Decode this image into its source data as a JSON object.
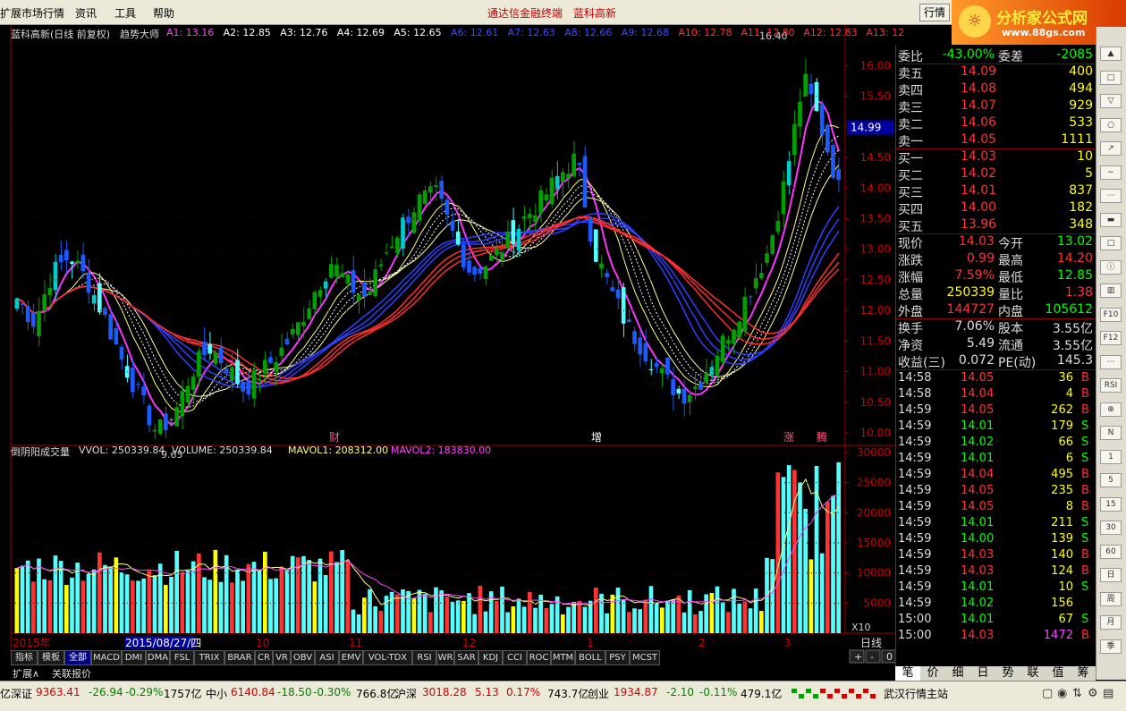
{
  "menubar": {
    "items": [
      "扩展市场行情",
      "资讯",
      "工具",
      "帮助"
    ],
    "app_title": "通达信金融终端",
    "stock_name": "蓝科高新",
    "quote_button": "行情"
  },
  "logo": {
    "title": "分析家公式网",
    "url": "www.88gs.com"
  },
  "main_chart": {
    "header_name": "蓝科高新(日线 前复权)",
    "header_indicator": "趋势大师",
    "lines": [
      {
        "label": "A1: 13.16",
        "color": "#ff44ff"
      },
      {
        "label": "A2: 12.85",
        "color": "#ffffff"
      },
      {
        "label": "A3: 12.76",
        "color": "#ffffff"
      },
      {
        "label": "A4: 12.69",
        "color": "#ffffff"
      },
      {
        "label": "A5: 12.65",
        "color": "#ffffff"
      },
      {
        "label": "A6: 12.61",
        "color": "#3b4bff"
      },
      {
        "label": "A7: 12.63",
        "color": "#3b4bff"
      },
      {
        "label": "A8: 12.66",
        "color": "#3b4bff"
      },
      {
        "label": "A9: 12.68",
        "color": "#3b4bff"
      },
      {
        "label": "A10: 12.78",
        "color": "#ff3333"
      },
      {
        "label": "A11: 12.80",
        "color": "#ff3333"
      },
      {
        "label": "A12: 12.83",
        "color": "#ff3333"
      },
      {
        "label": "A13: 12",
        "color": "#ff3333"
      }
    ],
    "price_axis": [
      "16.00",
      "15.50",
      "15.00",
      "14.50",
      "14.00",
      "13.50",
      "13.00",
      "12.50",
      "12.00",
      "11.50",
      "11.00",
      "10.50",
      "10.00"
    ],
    "current_price_marker": "14.99",
    "high_annotation": "16.40",
    "low_annotation": "9.65",
    "low_mark_label": "9.65",
    "event_marks": [
      "财",
      "增",
      "涨",
      "腾"
    ]
  },
  "volume_chart": {
    "label_name": "倒阴阳成交量",
    "vvol": "VVOL: 250339.84",
    "volume": "VOLUME: 250339.84",
    "mavol1": "MAVOL1: 208312.00",
    "mavol2": "MAVOL2: 183830.00",
    "axis": [
      "30000",
      "25000",
      "20000",
      "15000",
      "10000",
      "5000"
    ],
    "unit": "X10"
  },
  "chart_data": {
    "type": "candlestick",
    "title": "蓝科高新(日线 前复权)",
    "ylim": [
      9.65,
      16.4
    ],
    "high": 16.4,
    "low": 9.65,
    "volume_ylim": [
      0,
      30000
    ]
  },
  "time_axis": {
    "labels": [
      "2015年",
      "2015/08/27/四",
      "10",
      "11",
      "12",
      "1",
      "2",
      "3"
    ],
    "period": "日线"
  },
  "indicator_tabs": [
    "指标",
    "模板",
    "全部",
    "MACD",
    "DMI",
    "DMA",
    "FSL",
    "TRIX",
    "BRAR",
    "CR",
    "VR",
    "OBV",
    "ASI",
    "EMV",
    "VOL-TDX",
    "RSI",
    "WR",
    "SAR",
    "KDJ",
    "CCI",
    "ROC",
    "MTM",
    "BOLL",
    "PSY",
    "MCST"
  ],
  "bottom_links": [
    "扩展∧",
    "关联报价"
  ],
  "zoom_buttons": [
    "+",
    "-",
    "0"
  ],
  "right_panel": {
    "weibi": {
      "label": "委比",
      "value": "-43.00%",
      "label2": "委差",
      "value2": "-2085"
    },
    "sells": [
      {
        "label": "卖五",
        "price": "14.09",
        "vol": "400"
      },
      {
        "label": "卖四",
        "price": "14.08",
        "vol": "494"
      },
      {
        "label": "卖三",
        "price": "14.07",
        "vol": "929"
      },
      {
        "label": "卖二",
        "price": "14.06",
        "vol": "533"
      },
      {
        "label": "卖一",
        "price": "14.05",
        "vol": "1111"
      }
    ],
    "buys": [
      {
        "label": "买一",
        "price": "14.03",
        "vol": "10"
      },
      {
        "label": "买二",
        "price": "14.02",
        "vol": "5"
      },
      {
        "label": "买三",
        "price": "14.01",
        "vol": "837"
      },
      {
        "label": "买四",
        "price": "14.00",
        "vol": "182"
      },
      {
        "label": "买五",
        "price": "13.96",
        "vol": "348"
      }
    ],
    "stats": [
      {
        "l1": "现价",
        "v1": "14.03",
        "c1": "#ff3333",
        "l2": "今开",
        "v2": "13.02",
        "c2": "#00ff00"
      },
      {
        "l1": "涨跌",
        "v1": "0.99",
        "c1": "#ff3333",
        "l2": "最高",
        "v2": "14.20",
        "c2": "#ff3333"
      },
      {
        "l1": "涨幅",
        "v1": "7.59%",
        "c1": "#ff3333",
        "l2": "最低",
        "v2": "12.85",
        "c2": "#00ff00"
      },
      {
        "l1": "总量",
        "v1": "250339",
        "c1": "#ffff00",
        "l2": "量比",
        "v2": "1.38",
        "c2": "#ff3333"
      },
      {
        "l1": "外盘",
        "v1": "144727",
        "c1": "#ff3333",
        "l2": "内盘",
        "v2": "105612",
        "c2": "#00ff00"
      }
    ],
    "stats2": [
      {
        "l1": "换手",
        "v1": "7.06%",
        "l2": "股本",
        "v2": "3.55亿"
      },
      {
        "l1": "净资",
        "v1": "5.49",
        "l2": "流通",
        "v2": "3.55亿"
      },
      {
        "l1": "收益(三)",
        "v1": "0.072",
        "l2": "PE(动)",
        "v2": "145.3"
      }
    ],
    "ticks": [
      {
        "t": "14:58",
        "p": "14.05",
        "v": "36",
        "d": "B"
      },
      {
        "t": "14:58",
        "p": "14.04",
        "v": "4",
        "d": "B"
      },
      {
        "t": "14:59",
        "p": "14.05",
        "v": "262",
        "d": "B"
      },
      {
        "t": "14:59",
        "p": "14.01",
        "v": "179",
        "d": "S"
      },
      {
        "t": "14:59",
        "p": "14.02",
        "v": "66",
        "d": "S"
      },
      {
        "t": "14:59",
        "p": "14.01",
        "v": "6",
        "d": "S"
      },
      {
        "t": "14:59",
        "p": "14.04",
        "v": "495",
        "d": "B"
      },
      {
        "t": "14:59",
        "p": "14.05",
        "v": "235",
        "d": "B"
      },
      {
        "t": "14:59",
        "p": "14.05",
        "v": "8",
        "d": "B"
      },
      {
        "t": "14:59",
        "p": "14.01",
        "v": "211",
        "d": "S"
      },
      {
        "t": "14:59",
        "p": "14.00",
        "v": "139",
        "d": "S"
      },
      {
        "t": "14:59",
        "p": "14.03",
        "v": "140",
        "d": "B"
      },
      {
        "t": "14:59",
        "p": "14.03",
        "v": "124",
        "d": "B"
      },
      {
        "t": "14:59",
        "p": "14.01",
        "v": "10",
        "d": "S"
      },
      {
        "t": "14:59",
        "p": "14.02",
        "v": "156",
        "d": ""
      },
      {
        "t": "15:00",
        "p": "14.01",
        "v": "67",
        "d": "S"
      },
      {
        "t": "15:00",
        "p": "14.03",
        "v": "1472",
        "d": "B"
      }
    ],
    "tabs": [
      "笔",
      "价",
      "细",
      "日",
      "势",
      "联",
      "值",
      "筹"
    ]
  },
  "toolstrip": [
    "▲",
    "□",
    "▽",
    "○",
    "↗",
    "~",
    "⋯",
    "▬",
    "□",
    "ⓘ",
    "▥",
    "F10",
    "F12",
    "⋯",
    "RSI",
    "⊕",
    "N",
    "1",
    "5",
    "15",
    "30",
    "60",
    "日",
    "周",
    "月",
    "季"
  ],
  "statusbar": [
    {
      "label": "亿",
      "color": "#000"
    },
    {
      "label": "深证",
      "color": "#000"
    },
    {
      "label": "9363.41",
      "color": "#d00000"
    },
    {
      "label": "-26.94",
      "color": "#008000"
    },
    {
      "label": "-0.29%",
      "color": "#008000"
    },
    {
      "label": "1757亿",
      "color": "#000"
    },
    {
      "label": "中小",
      "color": "#000"
    },
    {
      "label": "6140.84",
      "color": "#d00000"
    },
    {
      "label": "-18.50",
      "color": "#008000"
    },
    {
      "label": "-0.30%",
      "color": "#008000"
    },
    {
      "label": "766.8亿",
      "color": "#000"
    },
    {
      "label": "沪深",
      "color": "#000"
    },
    {
      "label": "3018.28",
      "color": "#d00000"
    },
    {
      "label": "5.13",
      "color": "#d00000"
    },
    {
      "label": "0.17%",
      "color": "#d00000"
    },
    {
      "label": "743.7亿",
      "color": "#000"
    },
    {
      "label": "创业",
      "color": "#000"
    },
    {
      "label": "1934.87",
      "color": "#d00000"
    },
    {
      "label": "-2.10",
      "color": "#008000"
    },
    {
      "label": "-0.11%",
      "color": "#008000"
    },
    {
      "label": "479.1亿",
      "color": "#000"
    },
    {
      "label": "武汉行情主站",
      "color": "#000"
    }
  ]
}
